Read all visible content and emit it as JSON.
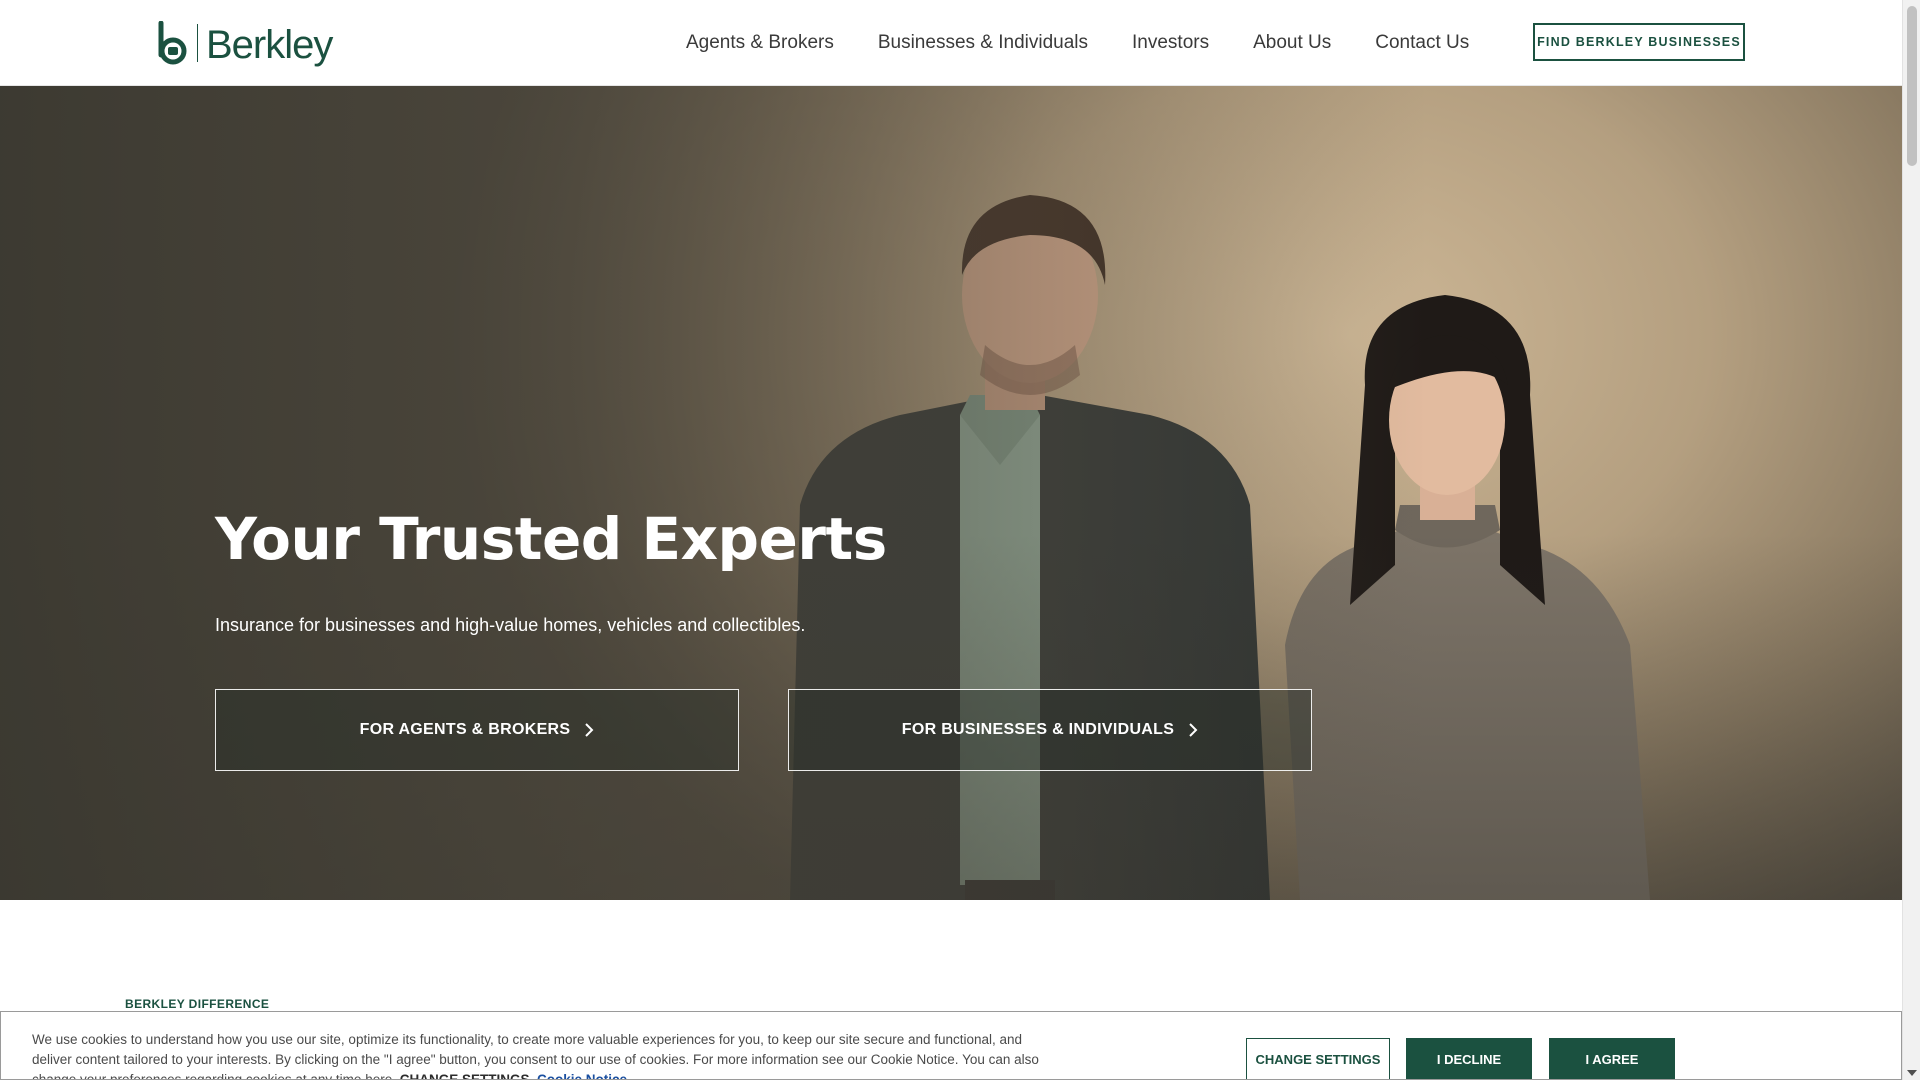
{
  "header": {
    "logo_text": "Berkley",
    "nav": [
      {
        "label": "Agents & Brokers"
      },
      {
        "label": "Businesses & Individuals"
      },
      {
        "label": "Investors"
      },
      {
        "label": "About Us"
      },
      {
        "label": "Contact Us"
      }
    ],
    "cta_label": "FIND BERKLEY BUSINESSES"
  },
  "hero": {
    "title": "Your Trusted Experts",
    "subtitle": "Insurance for businesses and high-value homes, vehicles and collectibles.",
    "buttons": [
      {
        "label": "FOR AGENTS & BROKERS"
      },
      {
        "label": "FOR BUSINESSES & INDIVIDUALS"
      }
    ]
  },
  "section": {
    "eyebrow": "BERKLEY DIFFERENCE"
  },
  "cookie": {
    "text": "We use cookies to understand how you use our site, optimize its functionality, to create more valuable experiences for you, to keep our site secure and functional, and deliver content tailored to your interests. By clicking on the \"I agree\" button, you consent to our use of cookies. For more information see our Cookie Notice. You can also change your preferences regarding cookies at any time here.",
    "settings_link": "CHANGE SETTINGS.",
    "notice_link": "Cookie Notice",
    "buttons": {
      "settings": "CHANGE SETTINGS",
      "decline": "I DECLINE",
      "agree": "I AGREE"
    }
  },
  "colors": {
    "brand_green": "#1b5140",
    "link_blue": "#1a4fa0"
  },
  "icons": {
    "logo": "berkley-b-logo-icon",
    "chevron": "chevron-right-icon"
  }
}
